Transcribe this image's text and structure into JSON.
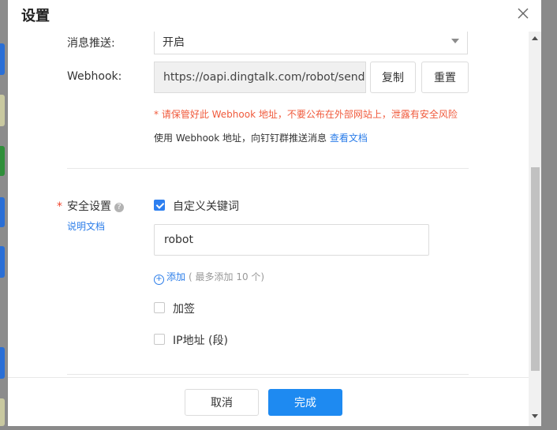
{
  "dialog": {
    "title": "设置"
  },
  "push": {
    "label": "消息推送:",
    "value": "开启"
  },
  "webhook": {
    "label": "Webhook:",
    "url": "https://oapi.dingtalk.com/robot/send",
    "copy_label": "复制",
    "reset_label": "重置",
    "warning": "* 请保管好此 Webhook 地址，不要公布在外部网站上，泄露有安全风险",
    "tip_text": "使用 Webhook 地址，向钉钉群推送消息",
    "doc_link": "查看文档"
  },
  "security": {
    "required_mark": "*",
    "label": "安全设置",
    "help_icon": "?",
    "doc_link": "说明文档",
    "keyword_option": "自定义关键词",
    "keyword_value": "robot",
    "add_icon": "+",
    "add_label": "添加",
    "add_hint": "( 最多添加 10 个)",
    "sign_option": "加签",
    "ip_option": "IP地址 (段)"
  },
  "footer": {
    "cancel_label": "取消",
    "ok_label": "完成"
  },
  "colors": {
    "primary": "#1e8af1",
    "warning": "#f05a3c",
    "link": "#2b7de9"
  }
}
